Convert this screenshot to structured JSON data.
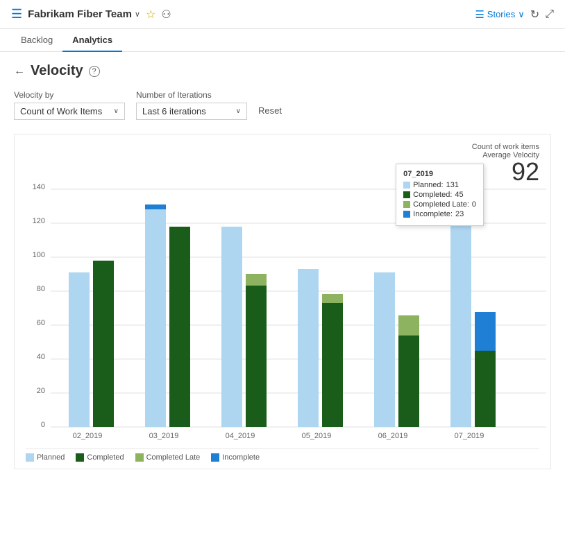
{
  "header": {
    "icon": "☰",
    "team_name": "Fabrikam Fiber Team",
    "chevron": "∨",
    "star": "☆",
    "people_icon": "👥",
    "stories_label": "Stories",
    "stories_chevron": "∨"
  },
  "nav": {
    "tabs": [
      {
        "id": "backlog",
        "label": "Backlog",
        "active": false
      },
      {
        "id": "analytics",
        "label": "Analytics",
        "active": true
      }
    ]
  },
  "page": {
    "title": "Velocity",
    "back_label": "←",
    "help_label": "?"
  },
  "filters": {
    "velocity_by_label": "Velocity by",
    "velocity_by_value": "Count of Work Items",
    "iterations_label": "Number of Iterations",
    "iterations_value": "Last 6 iterations",
    "reset_label": "Reset"
  },
  "chart": {
    "metric_label": "Count of work items",
    "velocity_label": "Average Velocity",
    "velocity_value": "92",
    "y_axis": [
      0,
      20,
      40,
      60,
      80,
      100,
      120,
      140
    ],
    "series": [
      {
        "sprint": "02_2019",
        "planned": 91,
        "completed": 98,
        "completed_late": 0,
        "incomplete": 0
      },
      {
        "sprint": "03_2019",
        "planned": 129,
        "completed": 118,
        "completed_late": 0,
        "incomplete": 0
      },
      {
        "sprint": "04_2019",
        "planned": 118,
        "completed": 83,
        "completed_late": 7,
        "incomplete": 0
      },
      {
        "sprint": "05_2019",
        "planned": 93,
        "completed": 73,
        "completed_late": 5,
        "incomplete": 0
      },
      {
        "sprint": "06_2019",
        "planned": 91,
        "completed": 54,
        "completed_late": 12,
        "incomplete": 0
      },
      {
        "sprint": "07_2019",
        "planned": 131,
        "completed": 45,
        "completed_late": 0,
        "incomplete": 23
      }
    ],
    "tooltip": {
      "sprint": "07_2019",
      "planned_label": "Planned:",
      "planned_value": "131",
      "completed_label": "Completed:",
      "completed_value": "45",
      "completed_late_label": "Completed Late:",
      "completed_late_value": "0",
      "incomplete_label": "Incomplete:",
      "incomplete_value": "23"
    },
    "legend": [
      {
        "label": "Planned",
        "color": "#aed6f1"
      },
      {
        "label": "Completed",
        "color": "#1a5c1a"
      },
      {
        "label": "Completed Late",
        "color": "#8db360"
      },
      {
        "label": "Incomplete",
        "color": "#1e7fd4"
      }
    ]
  }
}
